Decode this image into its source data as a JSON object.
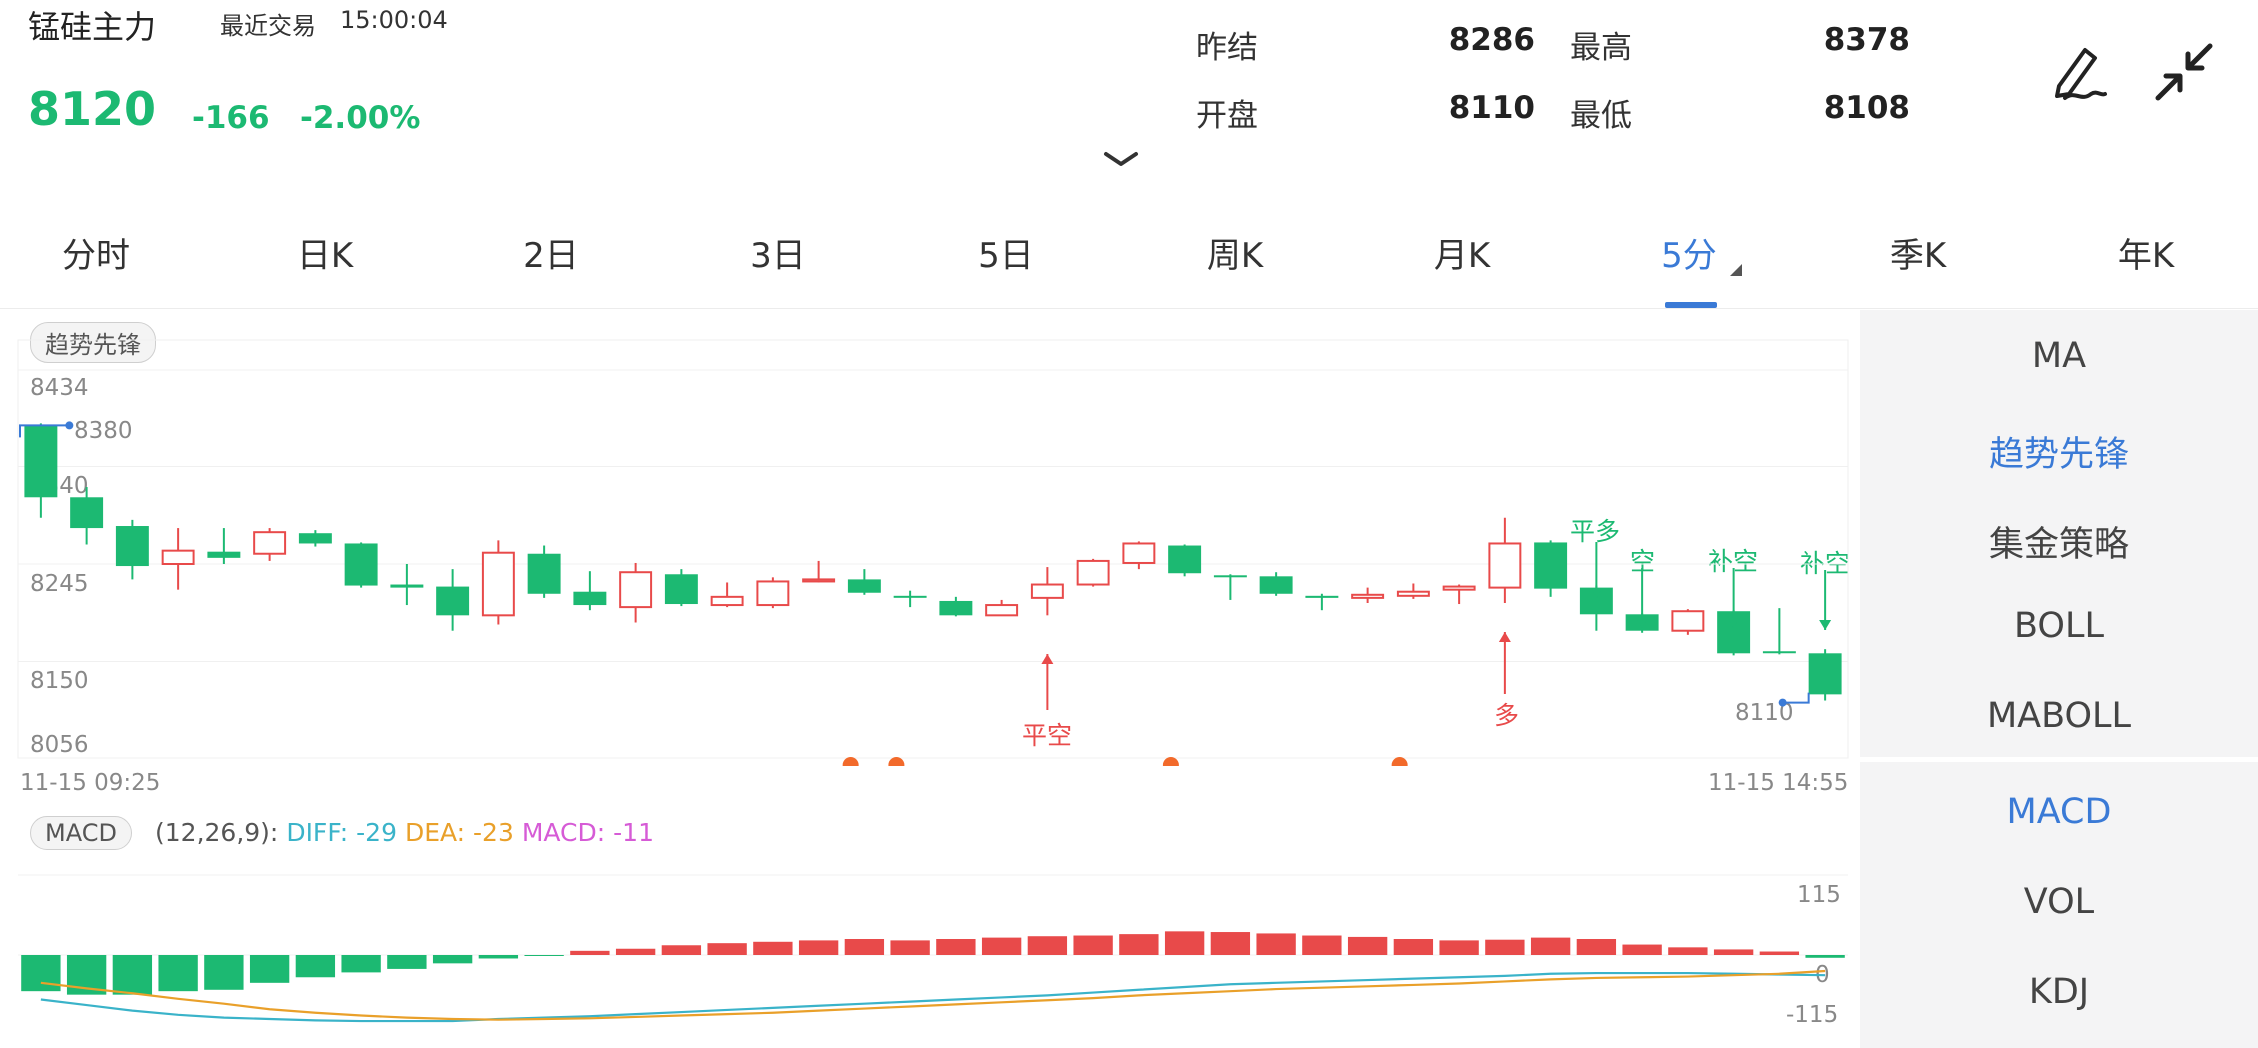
{
  "header": {
    "name": "锰硅主力",
    "recent_label": "最近交易",
    "time": "15:00:04",
    "price": "8120",
    "change": "-166",
    "change_pct": "-2.00%",
    "stats": [
      {
        "label": "昨结",
        "value": "8286"
      },
      {
        "label": "最高",
        "value": "8378"
      },
      {
        "label": "开盘",
        "value": "8110"
      },
      {
        "label": "最低",
        "value": "8108"
      }
    ]
  },
  "tabs": [
    "分时",
    "日K",
    "2日",
    "3日",
    "5日",
    "周K",
    "月K",
    "5分",
    "季K",
    "年K"
  ],
  "active_tab": "5分",
  "indicators_main": [
    "MA",
    "趋势先锋",
    "集金策略",
    "BOLL",
    "MABOLL"
  ],
  "active_main": "趋势先锋",
  "indicators_sub": [
    "MACD",
    "VOL",
    "KDJ"
  ],
  "active_sub": "MACD",
  "main_chip": "趋势先锋",
  "main_chart": {
    "y_ticks": [
      "8434",
      "8340",
      "8245",
      "8150",
      "8056"
    ],
    "high_label": "8380",
    "low_label": "8110",
    "x_start": "11-15 09:25",
    "x_end": "11-15 14:55",
    "signals": [
      "平空",
      "多",
      "平多",
      "空",
      "补空",
      "补空"
    ]
  },
  "macd": {
    "chip": "MACD",
    "params": "(12,26,9):",
    "diff_label": "DIFF:",
    "diff_value": "-29",
    "dea_label": "DEA:",
    "dea_value": "-23",
    "macd_label": "MACD:",
    "macd_value": "-11",
    "y_ticks": [
      "115",
      "0",
      "-115"
    ]
  },
  "colors": {
    "up": "#e84a4a",
    "down": "#1cb972",
    "accent": "#3a7ad6",
    "diff": "#3ab3c9",
    "dea": "#e9a02a",
    "macd": "#d65bd6",
    "dot": "#f26a2b"
  },
  "chart_data": [
    {
      "type": "candlestick",
      "title": "",
      "ylim": [
        8056,
        8434
      ],
      "y_ticks": [
        8434,
        8340,
        8245,
        8150,
        8056
      ],
      "x_range": [
        "11-15 09:25",
        "11-15 14:55"
      ],
      "candles": [
        {
          "o": 8380,
          "c": 8310,
          "h": 8382,
          "l": 8290
        },
        {
          "o": 8310,
          "c": 8280,
          "h": 8320,
          "l": 8264
        },
        {
          "o": 8282,
          "c": 8243,
          "h": 8288,
          "l": 8230
        },
        {
          "o": 8245,
          "c": 8258,
          "h": 8280,
          "l": 8220
        },
        {
          "o": 8257,
          "c": 8251,
          "h": 8280,
          "l": 8245
        },
        {
          "o": 8255,
          "c": 8276,
          "h": 8280,
          "l": 8248
        },
        {
          "o": 8275,
          "c": 8265,
          "h": 8278,
          "l": 8262
        },
        {
          "o": 8265,
          "c": 8224,
          "h": 8266,
          "l": 8222
        },
        {
          "o": 8225,
          "c": 8222,
          "h": 8245,
          "l": 8205
        },
        {
          "o": 8223,
          "c": 8195,
          "h": 8240,
          "l": 8180
        },
        {
          "o": 8195,
          "c": 8256,
          "h": 8268,
          "l": 8186
        },
        {
          "o": 8255,
          "c": 8216,
          "h": 8263,
          "l": 8212
        },
        {
          "o": 8218,
          "c": 8205,
          "h": 8238,
          "l": 8200
        },
        {
          "o": 8203,
          "c": 8237,
          "h": 8246,
          "l": 8188
        },
        {
          "o": 8235,
          "c": 8206,
          "h": 8240,
          "l": 8204
        },
        {
          "o": 8205,
          "c": 8213,
          "h": 8227,
          "l": 8203
        },
        {
          "o": 8205,
          "c": 8228,
          "h": 8232,
          "l": 8202
        },
        {
          "o": 8228,
          "c": 8230,
          "h": 8248,
          "l": 8227
        },
        {
          "o": 8230,
          "c": 8217,
          "h": 8240,
          "l": 8215
        },
        {
          "o": 8214,
          "c": 8213,
          "h": 8219,
          "l": 8203
        },
        {
          "o": 8209,
          "c": 8195,
          "h": 8213,
          "l": 8194
        },
        {
          "o": 8195,
          "c": 8205,
          "h": 8210,
          "l": 8195
        },
        {
          "o": 8212,
          "c": 8225,
          "h": 8242,
          "l": 8195
        },
        {
          "o": 8225,
          "c": 8248,
          "h": 8250,
          "l": 8223
        },
        {
          "o": 8246,
          "c": 8265,
          "h": 8267,
          "l": 8240
        },
        {
          "o": 8263,
          "c": 8236,
          "h": 8264,
          "l": 8233
        },
        {
          "o": 8234,
          "c": 8233,
          "h": 8235,
          "l": 8210
        },
        {
          "o": 8233,
          "c": 8216,
          "h": 8237,
          "l": 8214
        },
        {
          "o": 8214,
          "c": 8212,
          "h": 8216,
          "l": 8200
        },
        {
          "o": 8212,
          "c": 8215,
          "h": 8222,
          "l": 8207
        },
        {
          "o": 8214,
          "c": 8218,
          "h": 8226,
          "l": 8211
        },
        {
          "o": 8220,
          "c": 8223,
          "h": 8225,
          "l": 8206
        },
        {
          "o": 8222,
          "c": 8265,
          "h": 8290,
          "l": 8207
        },
        {
          "o": 8266,
          "c": 8221,
          "h": 8268,
          "l": 8213
        },
        {
          "o": 8222,
          "c": 8196,
          "h": 8224,
          "l": 8180
        },
        {
          "o": 8196,
          "c": 8180,
          "h": 8197,
          "l": 8178
        },
        {
          "o": 8180,
          "c": 8199,
          "h": 8201,
          "l": 8176
        },
        {
          "o": 8199,
          "c": 8158,
          "h": 8200,
          "l": 8156
        },
        {
          "o": 8160,
          "c": 8159,
          "h": 8202,
          "l": 8157
        },
        {
          "o": 8158,
          "c": 8118,
          "h": 8162,
          "l": 8112
        }
      ]
    },
    {
      "type": "bar",
      "title": "MACD",
      "ylim": [
        -115,
        115
      ],
      "series": [
        {
          "name": "MACD",
          "values": [
            -52,
            -57,
            -57,
            -52,
            -50,
            -40,
            -32,
            -25,
            -20,
            -12,
            -5,
            -1,
            6,
            9,
            14,
            17,
            19,
            21,
            23,
            21,
            23,
            25,
            27,
            28,
            30,
            34,
            33,
            31,
            28,
            26,
            23,
            21,
            22,
            25,
            23,
            15,
            11,
            8,
            5,
            -4
          ]
        },
        {
          "name": "DIFF",
          "values": [
            -64,
            -72,
            -80,
            -86,
            -90,
            -92,
            -94,
            -95,
            -95,
            -95,
            -92,
            -90,
            -88,
            -85,
            -82,
            -79,
            -76,
            -73,
            -70,
            -67,
            -64,
            -61,
            -58,
            -54,
            -50,
            -46,
            -42,
            -40,
            -38,
            -36,
            -34,
            -32,
            -30,
            -27,
            -26,
            -26,
            -26,
            -27,
            -28,
            -29
          ]
        },
        {
          "name": "DEA",
          "values": [
            -40,
            -48,
            -55,
            -63,
            -70,
            -78,
            -83,
            -87,
            -90,
            -92,
            -93,
            -92,
            -91,
            -89,
            -87,
            -85,
            -83,
            -80,
            -77,
            -74,
            -71,
            -68,
            -65,
            -62,
            -58,
            -55,
            -52,
            -49,
            -47,
            -45,
            -43,
            -41,
            -38,
            -35,
            -33,
            -32,
            -31,
            -29,
            -27,
            -23
          ]
        }
      ]
    }
  ]
}
